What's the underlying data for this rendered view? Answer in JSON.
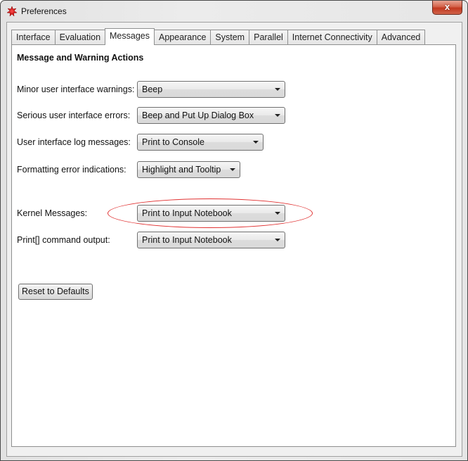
{
  "window": {
    "title": "Preferences",
    "close_label": "x",
    "icon": "wolfram-spikey-icon"
  },
  "tabs": [
    {
      "label": "Interface",
      "active": false
    },
    {
      "label": "Evaluation",
      "active": false
    },
    {
      "label": "Messages",
      "active": true
    },
    {
      "label": "Appearance",
      "active": false
    },
    {
      "label": "System",
      "active": false
    },
    {
      "label": "Parallel",
      "active": false
    },
    {
      "label": "Internet Connectivity",
      "active": false
    },
    {
      "label": "Advanced",
      "active": false
    }
  ],
  "panel": {
    "section_title": "Message and Warning Actions",
    "settings": [
      {
        "label": "Minor user interface warnings:",
        "value": "Beep"
      },
      {
        "label": "Serious user interface errors:",
        "value": "Beep and Put Up Dialog Box"
      },
      {
        "label": "User interface log messages:",
        "value": "Print to Console"
      },
      {
        "label": "Formatting error indications:",
        "value": "Highlight and Tooltip"
      },
      {
        "label": "Kernel Messages:",
        "value": "Print to Input Notebook",
        "highlighted": true
      },
      {
        "label": "Print[] command output:",
        "value": "Print to Input Notebook"
      }
    ],
    "reset_label": "Reset to Defaults"
  },
  "colors": {
    "highlight_ellipse": "#e03030",
    "close_button": "#c2391f"
  }
}
